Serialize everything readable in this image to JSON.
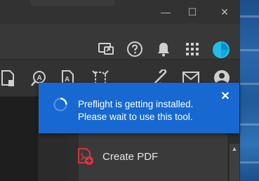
{
  "titlebar": {
    "minimize_glyph": "—",
    "maximize_glyph": "☐",
    "close_glyph": "✕"
  },
  "header_icons": [
    "share-screen-icon",
    "help-icon",
    "bell-icon",
    "apps-grid-icon",
    "avatar"
  ],
  "tool_icons": [
    "edit-pdf-icon",
    "search-text-icon",
    "pdf-text-icon",
    "compress-icon",
    "link-icon",
    "mail-icon",
    "account-icon"
  ],
  "toast": {
    "message_line1": "Preflight is getting installed.",
    "message_line2": "Please wait to use this tool.",
    "close_glyph": "✕",
    "background": "#1769d1"
  },
  "panel": {
    "create_pdf_label": "Create PDF",
    "create_pdf_icon": "create-pdf-icon",
    "accent": "#e2353f"
  },
  "scrollbar": {
    "up_glyph": "▲"
  }
}
